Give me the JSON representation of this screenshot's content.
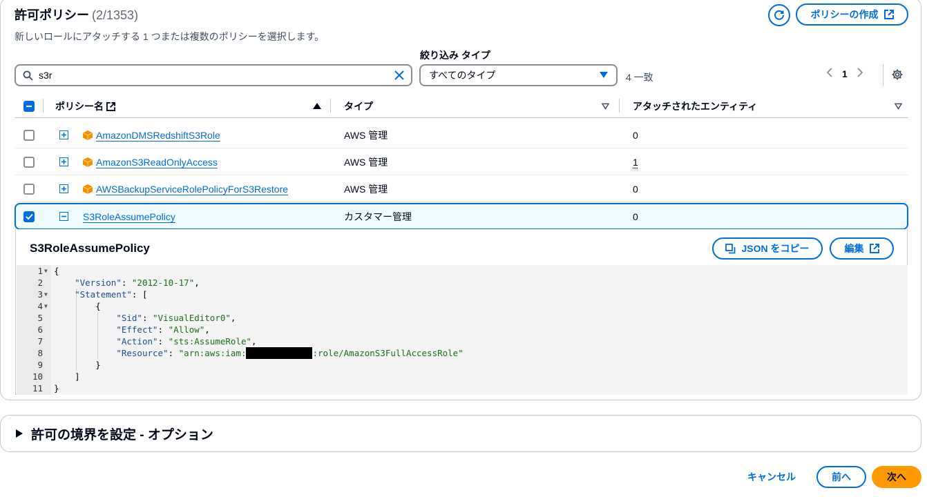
{
  "header": {
    "title": "許可ポリシー",
    "count": "(2/1353)",
    "subtitle": "新しいロールにアタッチする 1 つまたは複数のポリシーを選択します。",
    "create_label": "ポリシーの作成"
  },
  "filter": {
    "type_label": "絞り込み タイプ",
    "search_value": "s3r",
    "type_value": "すべてのタイプ",
    "match_text": "4 一致"
  },
  "pagination": {
    "current_page": "1"
  },
  "table": {
    "columns": [
      "ポリシー名",
      "タイプ",
      "アタッチされたエンティティ"
    ],
    "rows": [
      {
        "name": "AmazonDMSRedshiftS3Role",
        "type": "AWS 管理",
        "entities": "0",
        "checked": false
      },
      {
        "name": "AmazonS3ReadOnlyAccess",
        "type": "AWS 管理",
        "entities": "1",
        "checked": false
      },
      {
        "name": "AWSBackupServiceRolePolicyForS3Restore",
        "type": "AWS 管理",
        "entities": "0",
        "checked": false
      },
      {
        "name": "S3RoleAssumePolicy",
        "type": "カスタマー管理",
        "entities": "0",
        "checked": true
      }
    ]
  },
  "detail": {
    "title": "S3RoleAssumePolicy",
    "copy_json_label": "JSON をコピー",
    "edit_label": "編集",
    "code": {
      "line_numbers": [
        "1",
        "2",
        "3",
        "4",
        "5",
        "6",
        "7",
        "8",
        "9",
        "10",
        "11"
      ],
      "version_key": "\"Version\"",
      "version_val": "\"2012-10-17\"",
      "statement_key": "\"Statement\"",
      "sid_key": "\"Sid\"",
      "sid_val": "\"VisualEditor0\"",
      "effect_key": "\"Effect\"",
      "effect_val": "\"Allow\"",
      "action_key": "\"Action\"",
      "action_val": "\"sts:AssumeRole\"",
      "resource_key": "\"Resource\"",
      "resource_prefix": "\"arn:aws:iam:",
      "resource_suffix": ":role/AmazonS3FullAccessRole\""
    }
  },
  "boundary": {
    "label": "許可の境界を設定 - オプション"
  },
  "footer": {
    "cancel_label": "キャンセル",
    "prev_label": "前へ",
    "next_label": "次へ"
  },
  "colors": {
    "accent": "#006ce0",
    "primary_button": "#ff9900",
    "aws_icon": "#f29100"
  }
}
